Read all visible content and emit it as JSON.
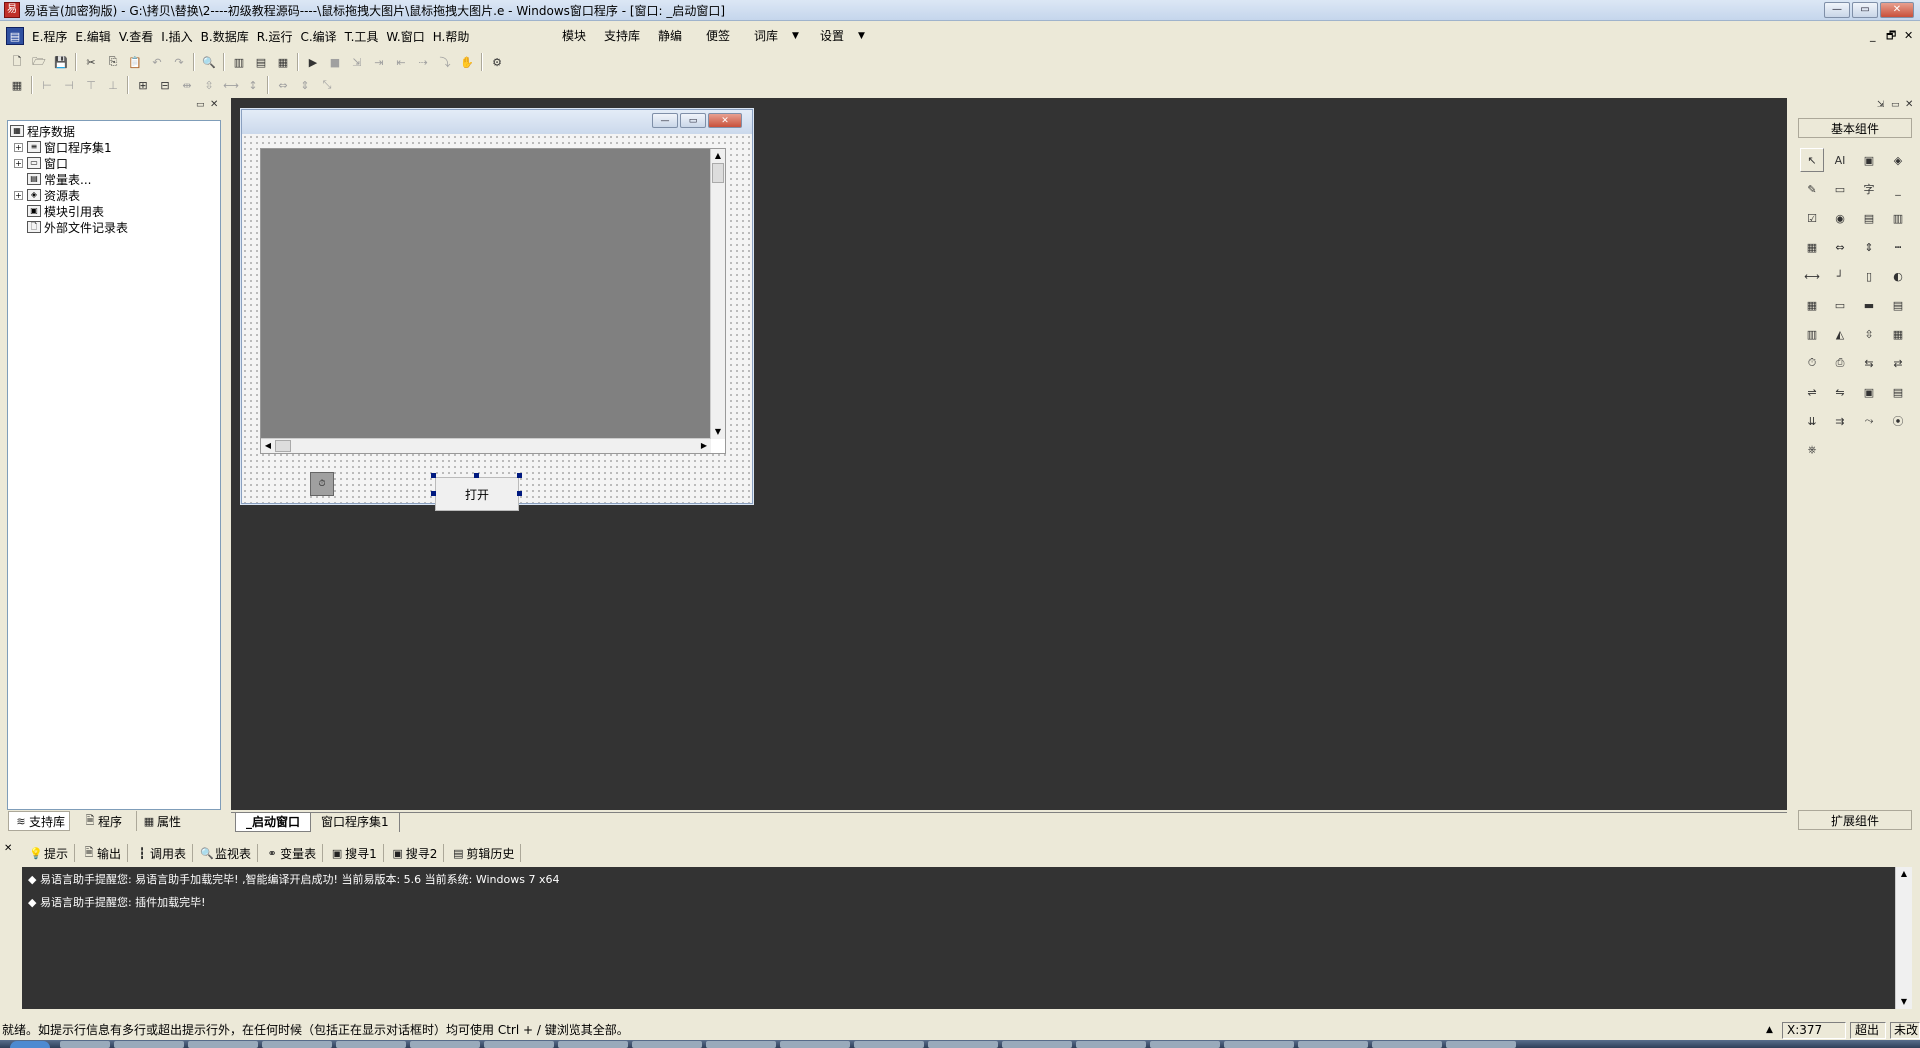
{
  "window": {
    "title": "易语言(加密狗版) - G:\\拷贝\\替换\\2----初级教程源码----\\鼠标拖拽大图片\\鼠标拖拽大图片.e - Windows窗口程序 - [窗口: _启动窗口]",
    "minimize": "—",
    "maximize": "▭",
    "close": "✕"
  },
  "menu": {
    "items": [
      "E.程序",
      "E.编辑",
      "V.查看",
      "I.插入",
      "B.数据库",
      "R.运行",
      "C.编译",
      "T.工具",
      "W.窗口",
      "H.帮助"
    ],
    "extra": [
      "模块",
      "支持库",
      "静编",
      "便签",
      "词库",
      "设置"
    ],
    "dropdown_arrow": "▼",
    "mdi_buttons": [
      "_",
      "🗗",
      "✕"
    ]
  },
  "toolbar1": {
    "icons": [
      "new-file-icon",
      "open-file-icon",
      "save-icon",
      "cut-icon",
      "copy-icon",
      "paste-icon",
      "undo-icon",
      "redo-icon",
      "find-icon",
      "layout1-icon",
      "layout2-icon",
      "layout3-icon",
      "run-icon",
      "stop-icon",
      "step1-icon",
      "step2-icon",
      "step3-icon",
      "step4-icon",
      "step5-icon",
      "hand-icon",
      "debug-icon"
    ]
  },
  "left_panel": {
    "tree": [
      {
        "label": "程序数据",
        "level": 0,
        "expand": ""
      },
      {
        "label": "窗口程序集1",
        "level": 1,
        "expand": "+"
      },
      {
        "label": "窗口",
        "level": 1,
        "expand": "+"
      },
      {
        "label": "常量表...",
        "level": 1,
        "expand": ""
      },
      {
        "label": "资源表",
        "level": 1,
        "expand": "+"
      },
      {
        "label": "模块引用表",
        "level": 1,
        "expand": ""
      },
      {
        "label": "外部文件记录表",
        "level": 1,
        "expand": ""
      }
    ],
    "tabs": [
      "支持库",
      "程序",
      "属性"
    ]
  },
  "form": {
    "button_label": "打开",
    "scroll_up": "▲",
    "scroll_down": "▼",
    "scroll_left": "◀",
    "scroll_right": "▶",
    "caption_min": "—",
    "caption_max": "▭",
    "caption_close": "✕"
  },
  "design_tabs": [
    "_启动窗口",
    "窗口程序集1"
  ],
  "palette": {
    "header": "基本组件",
    "footer": "扩展组件",
    "cells": [
      "↖",
      "AI",
      "▣",
      "◈",
      "✎",
      "▭",
      "字",
      "_",
      "☑",
      "◉",
      "▤",
      "▥",
      "▦",
      "⇔",
      "⇕",
      "┅",
      "⟷",
      "┘",
      "▯",
      "◐",
      "▦",
      "▭",
      "▬",
      "▤",
      "▥",
      "◭",
      "⇳",
      "▦",
      "⏱",
      "⎙",
      "⇆",
      "⇄",
      "⇌",
      "⇋",
      "▣",
      "▤",
      "⇊",
      "⇉",
      "⤳",
      "⦿",
      "⎈"
    ]
  },
  "output_tabs": [
    "提示",
    "输出",
    "调用表",
    "监视表",
    "变量表",
    "搜寻1",
    "搜寻2",
    "剪辑历史"
  ],
  "output_lines": [
    "◆ 易语言助手提醒您: 易语言助手加载完毕! ,智能编译开启成功! 当前易版本: 5.6 当前系统: Windows 7 x64",
    "◆ 易语言助手提醒您: 插件加载完毕!"
  ],
  "status": {
    "text": "就绪。如提示行信息有多行或超出提示行外，在任何时候（包括正在显示对话框时）均可使用 Ctrl + / 键浏览其全部。",
    "x": "X:377",
    "overwrite": "超出",
    "unsaved": "未改"
  }
}
